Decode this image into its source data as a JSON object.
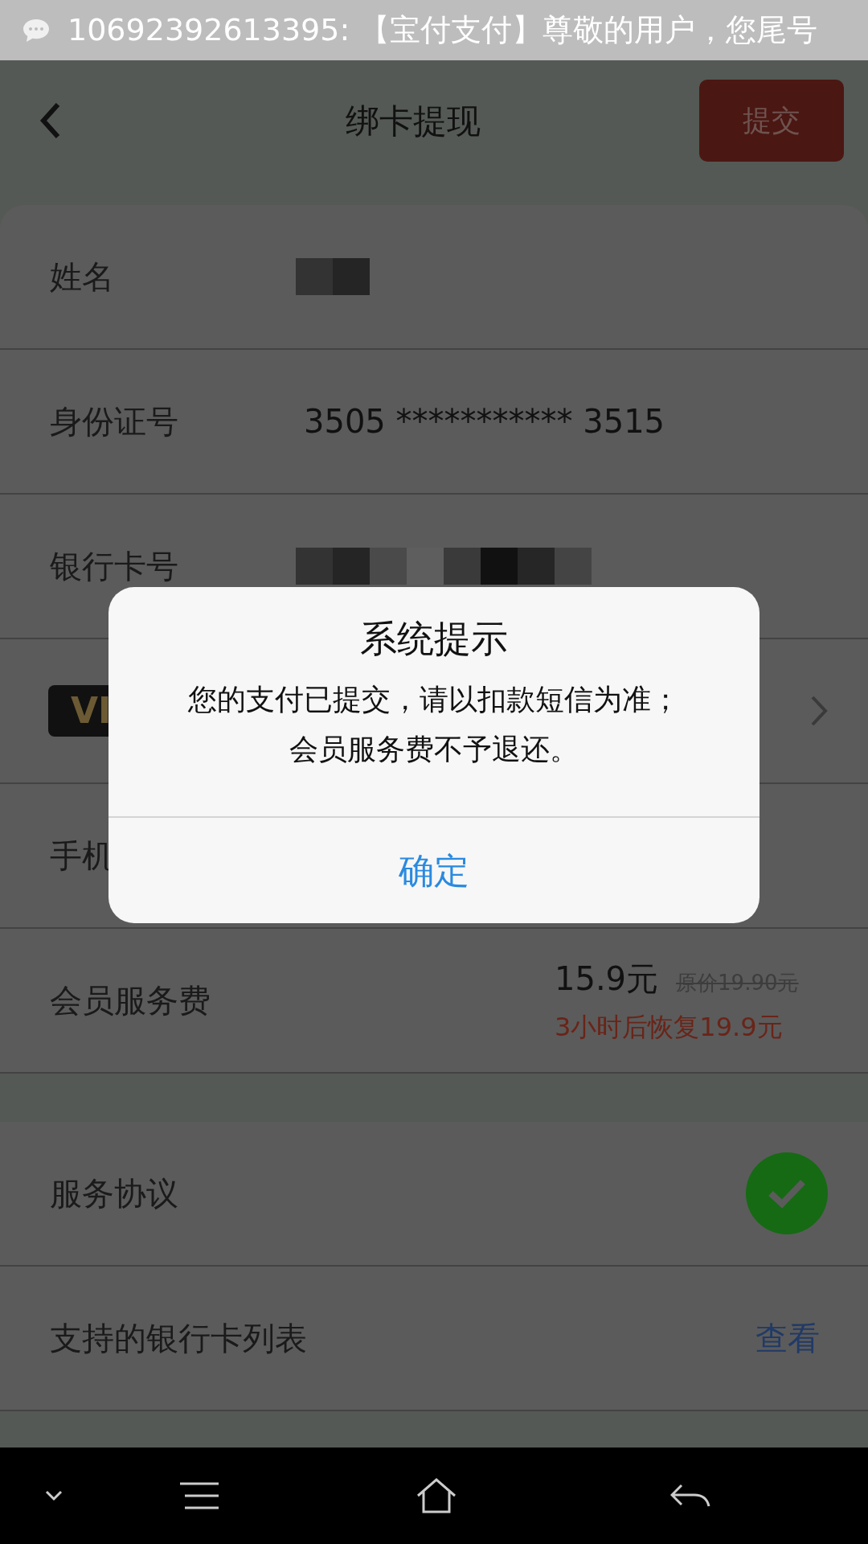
{
  "notification": {
    "text": "10692392613395: 【宝付支付】尊敬的用户，您尾号"
  },
  "header": {
    "title": "绑卡提现",
    "submit": "提交"
  },
  "rows": [
    {
      "kind": "masked-name",
      "label": "姓名"
    },
    {
      "kind": "text",
      "label": "身份证号",
      "value": "3505 *********** 3515"
    },
    {
      "kind": "masked-card",
      "label": "银行卡号"
    },
    {
      "kind": "vip",
      "badge": "VI"
    },
    {
      "kind": "label",
      "label": "手机"
    },
    {
      "kind": "fee",
      "label": "会员服务费",
      "price": "15.9元",
      "original": "原价19.90元",
      "note": "3小时后恢复19.9元"
    }
  ],
  "options": [
    {
      "kind": "check",
      "label": "服务协议",
      "checked": true
    },
    {
      "kind": "link",
      "label": "支持的银行卡列表",
      "action": "查看"
    }
  ],
  "dialog": {
    "title": "系统提示",
    "message": [
      "您的支付已提交，请以扣款短信为准；",
      "会员服务费不予退还。"
    ],
    "button": "确定"
  }
}
